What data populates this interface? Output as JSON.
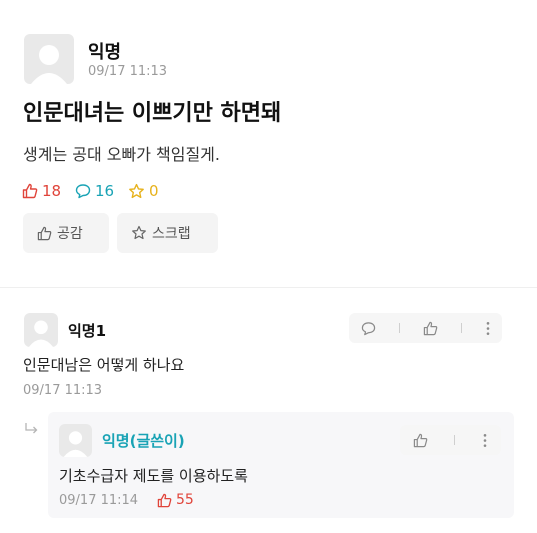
{
  "post": {
    "author": "익명",
    "time": "09/17 11:13",
    "title": "인문대녀는 이쁘기만 하면돼",
    "body": "생계는 공대 오빠가 책임질게.",
    "stats": {
      "likes": "18",
      "comments": "16",
      "scraps": "0"
    },
    "colors": {
      "likes": "#e0443a",
      "comments": "#19a3b5",
      "scraps": "#e7b21c"
    },
    "buttons": {
      "like": "공감",
      "scrap": "스크랩"
    }
  },
  "comments": [
    {
      "author": "익명1",
      "text": "인문대남은 어떻게 하나요",
      "time": "09/17 11:13"
    }
  ],
  "reply": {
    "author": "익명(글쓴이)",
    "author_color": "#19a3b5",
    "text": "기초수급자 제도를 이용하도록",
    "time": "09/17 11:14",
    "likes": "55",
    "likes_color": "#e0443a"
  },
  "icons": [
    "avatar-icon",
    "thumbs-up-icon",
    "speech-bubble-icon",
    "star-icon",
    "more-vertical-icon",
    "reply-arrow-icon"
  ]
}
